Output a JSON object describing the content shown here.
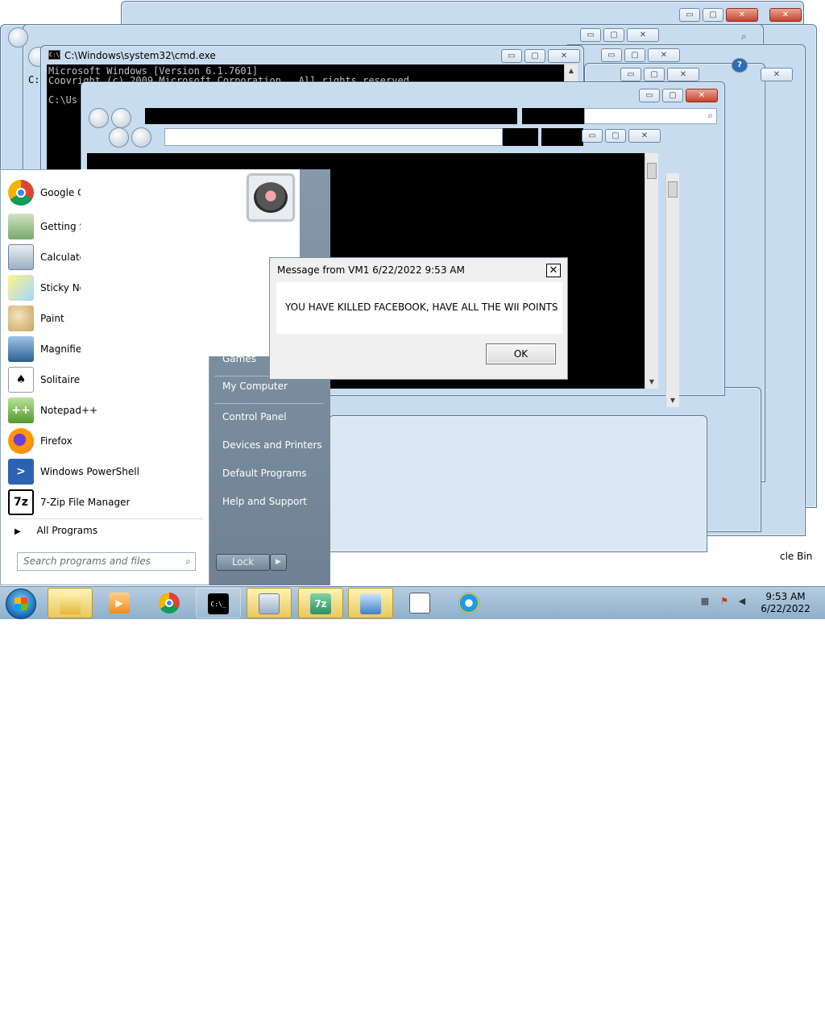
{
  "cmd": {
    "title": "C:\\Windows\\system32\\cmd.exe",
    "icon_text": "C:\\",
    "line1": "Microsoft Windows [Version 6.1.7601]",
    "line2": "Copyright (c) 2009 Microsoft Corporation.  All rights reserved.",
    "line3": "C:\\Us",
    "left_prompt": "C:"
  },
  "dialog": {
    "title": "Message from VM1 6/22/2022 9:53 AM",
    "close": "✕",
    "message": "YOU HAVE KILLED FACEBOOK, HAVE ALL THE WII POINTS",
    "ok": "OK"
  },
  "start_menu": {
    "programs": [
      {
        "label": "Google C",
        "icon": "chrome-icon"
      },
      {
        "label": "Getting S",
        "icon": "getting-started-icon"
      },
      {
        "label": "Calculato",
        "icon": "calculator-icon"
      },
      {
        "label": "Sticky No",
        "icon": "sticky-notes-icon"
      },
      {
        "label": "Paint",
        "icon": "paint-icon"
      },
      {
        "label": "Magnifier",
        "icon": "magnifier-icon"
      },
      {
        "label": "Solitaire",
        "icon": "solitaire-icon"
      },
      {
        "label": "Notepad++",
        "icon": "notepad-plus-plus-icon"
      },
      {
        "label": "Firefox",
        "icon": "firefox-icon"
      },
      {
        "label": "Windows PowerShell",
        "icon": "powershell-icon"
      },
      {
        "label": "7-Zip File Manager",
        "icon": "seven-zip-icon"
      }
    ],
    "all_programs": "All Programs",
    "search_placeholder": "Search programs and files",
    "right": {
      "games": "Games",
      "my_computer": "My Computer",
      "control_panel": "Control Panel",
      "devices": "Devices and Printers",
      "default_programs": "Default Programs",
      "help": "Help and Support"
    },
    "lock": "Lock",
    "lock_arrow": "▶"
  },
  "desktop": {
    "recycle_bin": "cle Bin"
  },
  "taskbar": {
    "time": "9:53 AM",
    "date": "6/22/2022",
    "cmd_glyph": "C:\\_",
    "seven_zip_glyph": "7z"
  },
  "window_buttons": {
    "minimize": "▭",
    "maximize": "▢",
    "close": "✕",
    "help": "?"
  }
}
